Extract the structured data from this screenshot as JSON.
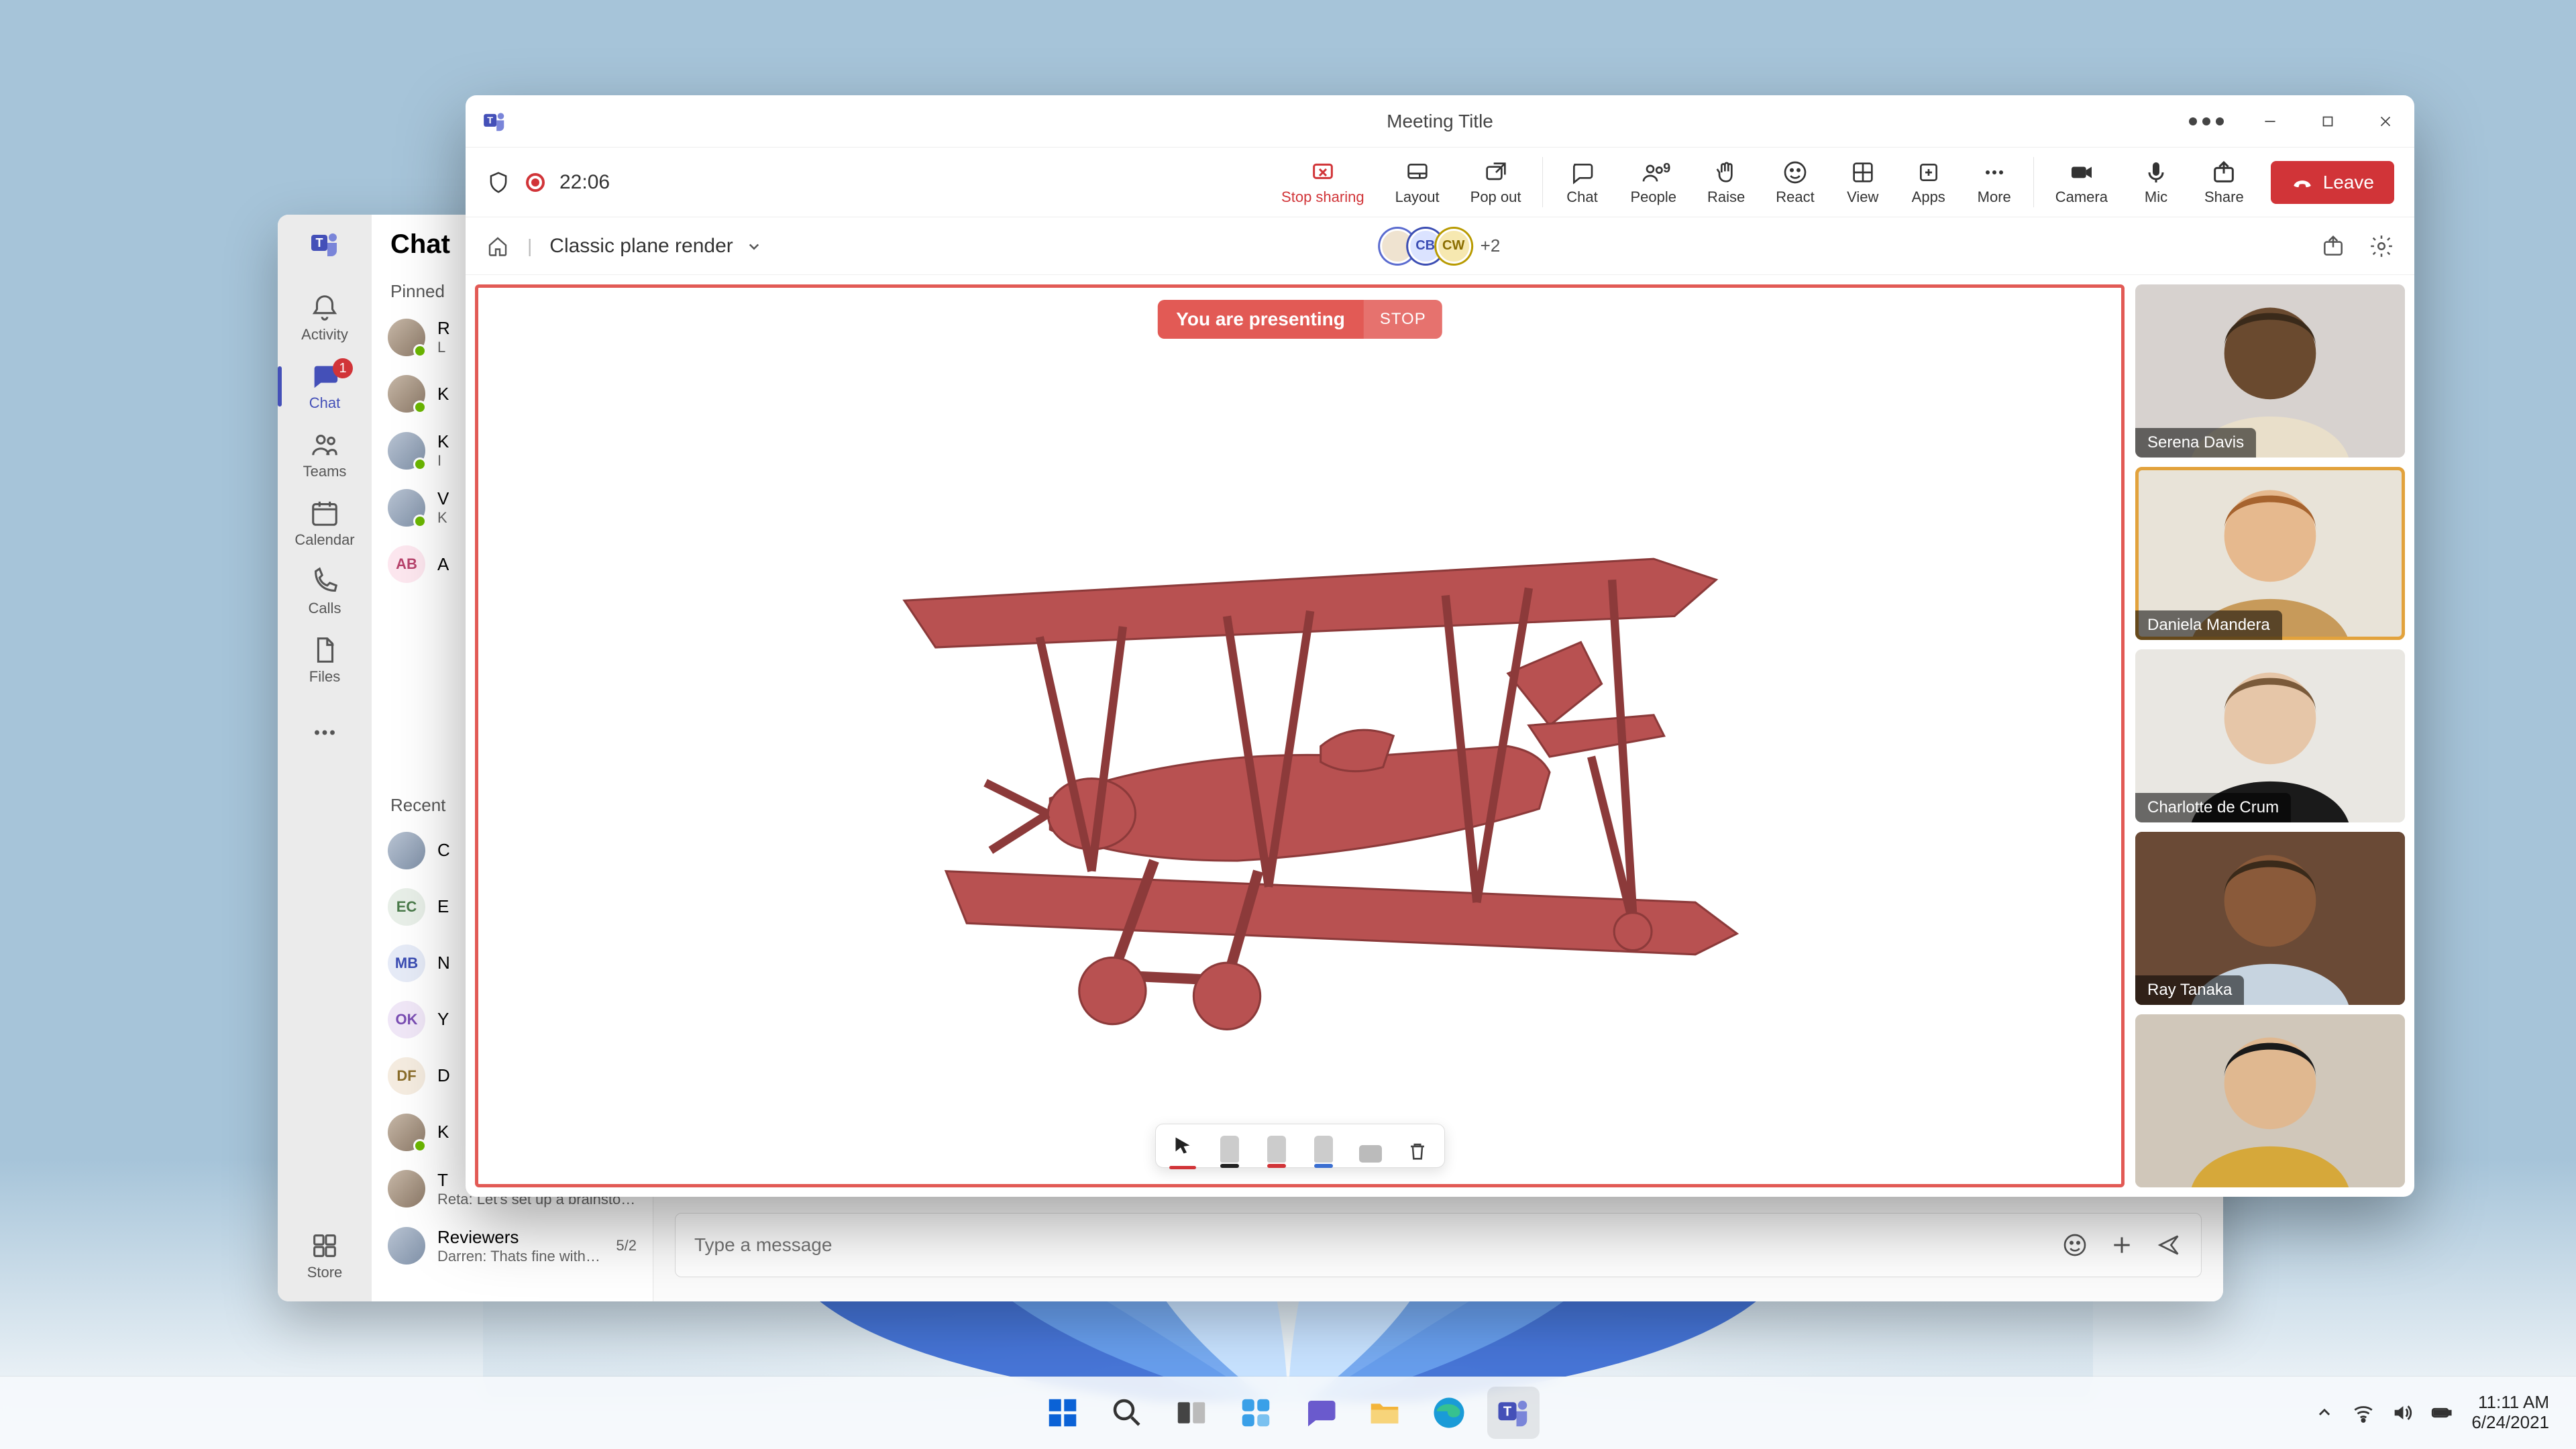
{
  "taskbar": {
    "time": "11:11 AM",
    "date": "6/24/2021",
    "apps": [
      "start",
      "search",
      "task-view",
      "widgets",
      "chat",
      "explorer",
      "edge",
      "teams"
    ]
  },
  "teams_main": {
    "rail": {
      "items": [
        {
          "key": "activity",
          "label": "Activity"
        },
        {
          "key": "chat",
          "label": "Chat",
          "badge": "1"
        },
        {
          "key": "teams",
          "label": "Teams"
        },
        {
          "key": "calendar",
          "label": "Calendar"
        },
        {
          "key": "calls",
          "label": "Calls"
        },
        {
          "key": "files",
          "label": "Files"
        }
      ],
      "store": "Store"
    },
    "chat_header": "Chat",
    "pinned_label": "Pinned",
    "recent_label": "Recent",
    "pinned": [
      {
        "name": "R",
        "preview": "L"
      },
      {
        "name": "K",
        "preview": ""
      },
      {
        "name": "K",
        "preview": "I"
      },
      {
        "name": "V",
        "preview": "K"
      },
      {
        "initials": "AB",
        "name": "A",
        "preview": ""
      }
    ],
    "recent": [
      {
        "name": "C",
        "preview": ""
      },
      {
        "initials": "EC",
        "name": "E",
        "preview": ""
      },
      {
        "initials": "MB",
        "name": "N",
        "preview": ""
      },
      {
        "initials": "OK",
        "name": "Y",
        "preview": ""
      },
      {
        "initials": "DF",
        "name": "D",
        "preview": ""
      },
      {
        "name": "K",
        "preview": ""
      },
      {
        "name": "T",
        "preview": "Reta: Let's set up a brainstorm session for..."
      },
      {
        "name": "Reviewers",
        "preview": "Darren: Thats fine with me",
        "side": "5/2"
      }
    ],
    "compose_placeholder": "Type a message"
  },
  "meeting": {
    "title": "Meeting Title",
    "timer": "22:06",
    "tools": {
      "stop_sharing": "Stop sharing",
      "layout": "Layout",
      "pop_out": "Pop out",
      "chat": "Chat",
      "people": "People",
      "people_count": "9",
      "raise": "Raise",
      "react": "React",
      "view": "View",
      "apps": "Apps",
      "more": "More",
      "camera": "Camera",
      "mic": "Mic",
      "share": "Share",
      "leave": "Leave"
    },
    "doc_title": "Classic plane render",
    "presence_extra": "+2",
    "presence_initials": [
      "",
      "CB",
      "CW"
    ],
    "presenting_text": "You are presenting",
    "presenting_stop": "STOP",
    "participants": [
      {
        "name": "Serena Davis",
        "speaking": false,
        "bg": "#d7d2cf",
        "skin": "#6a4a2f",
        "shirt": "#e9dfca"
      },
      {
        "name": "Daniela Mandera",
        "speaking": true,
        "bg": "#e8e3d8",
        "skin": "#e6b98e",
        "shirt": "#c79a5a",
        "hair": "#a6632e"
      },
      {
        "name": "Charlotte de Crum",
        "speaking": false,
        "bg": "#e9e7e2",
        "skin": "#e6c6a8",
        "shirt": "#1a1a1a",
        "hair": "#7a5a3a"
      },
      {
        "name": "Ray Tanaka",
        "speaking": false,
        "bg": "#6a4a36",
        "skin": "#8a5a3a",
        "shirt": "#c7d4e0"
      },
      {
        "name": "",
        "speaking": false,
        "bg": "#d0c7ba",
        "skin": "#e0b890",
        "shirt": "#d6a83a",
        "hair": "#1a1a1a"
      }
    ],
    "plane_color": "#b85151"
  }
}
